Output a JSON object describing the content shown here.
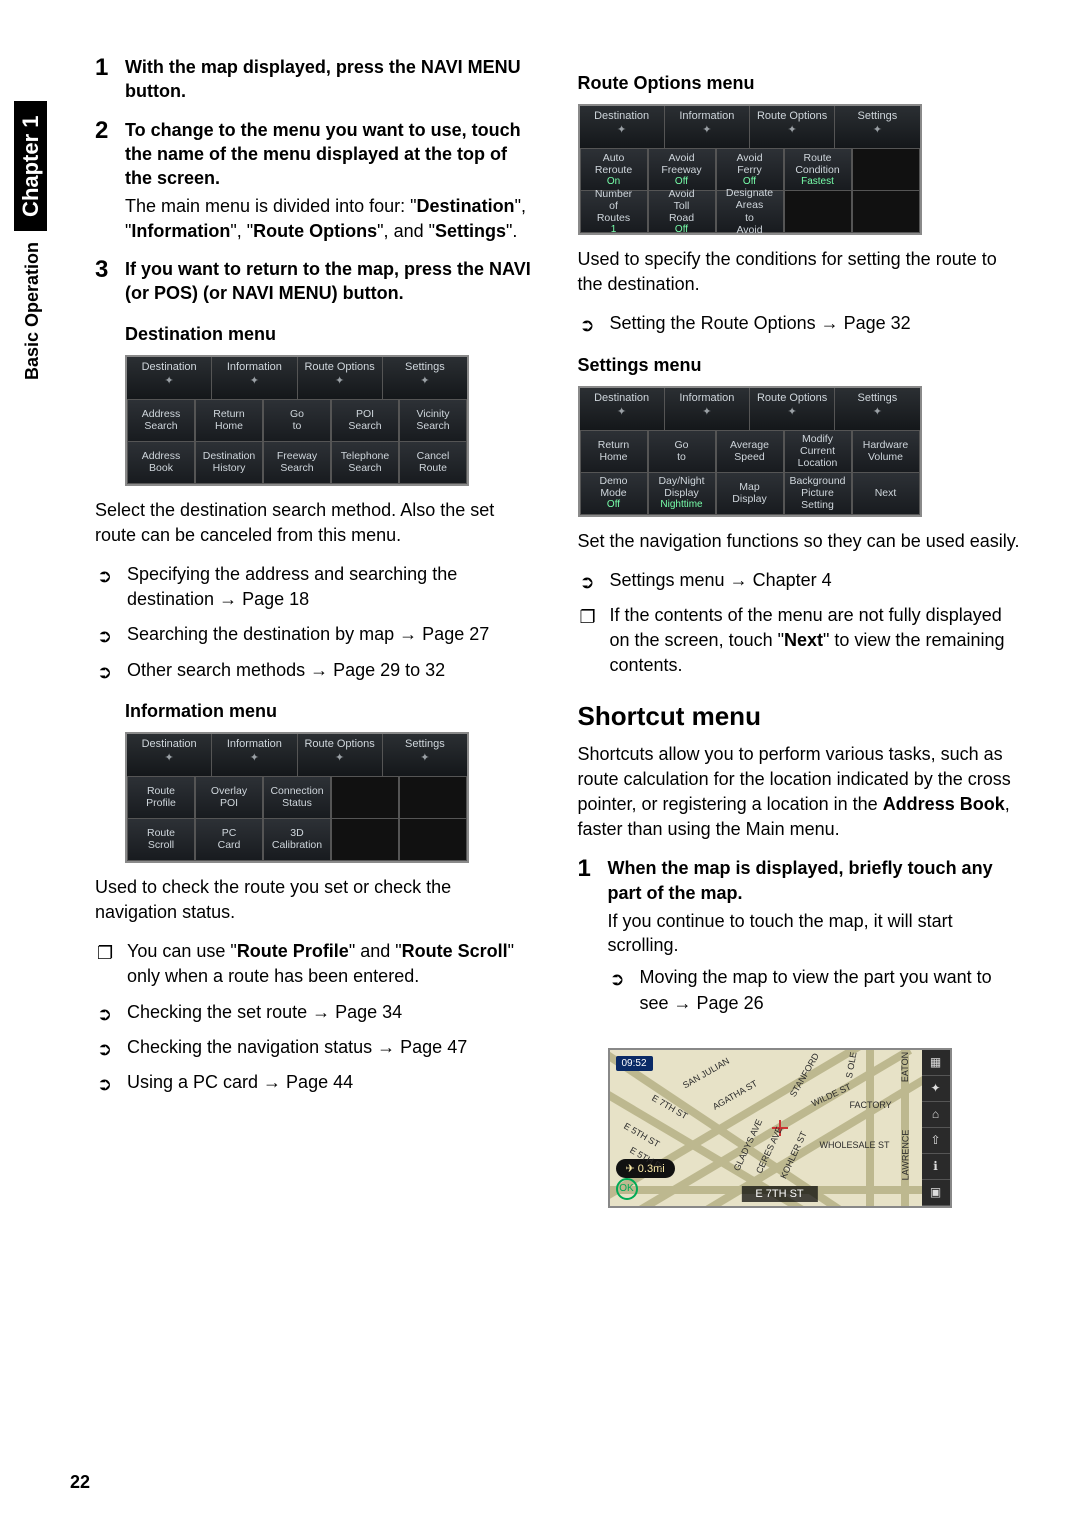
{
  "side": {
    "section": "Basic Operation",
    "chapter": "Chapter 1"
  },
  "page_number": "22",
  "steps_left": [
    {
      "num": "1",
      "lead_parts": [
        "With the map displayed, press the ",
        "NAVI MENU",
        " button."
      ],
      "detail": ""
    },
    {
      "num": "2",
      "lead": "To change to the menu you want to use, touch the name of the menu displayed at the top of the screen.",
      "detail_parts": [
        "The main menu is divided into four: \"",
        "Destination",
        "\", \"",
        "Information",
        "\", \"",
        "Route Options",
        "\", and \"",
        "Settings",
        "\"."
      ]
    },
    {
      "num": "3",
      "lead_parts": [
        "If you want to return to the map, press the ",
        "NAVI (or POS) (or NAVI MENU)",
        " button."
      ],
      "detail": ""
    }
  ],
  "tabs": [
    "Destination",
    "Information",
    "Route Options",
    "Settings"
  ],
  "dest_menu": {
    "title": "Destination menu",
    "rows": [
      [
        "Address Search",
        "Return Home",
        "Go to",
        "POI Search",
        "Vicinity Search"
      ],
      [
        "Address Book",
        "Destination History",
        "Freeway Search",
        "Telephone Search",
        "Cancel Route"
      ]
    ],
    "caption": "Select the destination search method. Also the set route can be canceled from this menu.",
    "refs": [
      {
        "m": "➲",
        "t": "Specifying the address and searching the destination → Page 18"
      },
      {
        "m": "➲",
        "t": "Searching the destination by map → Page 27"
      },
      {
        "m": "➲",
        "t": "Other search methods → Page 29 to 32"
      }
    ]
  },
  "info_menu": {
    "title": "Information menu",
    "rows": [
      [
        "Route Profile",
        "Overlay POI",
        "Connection Status",
        "",
        ""
      ],
      [
        "Route Scroll",
        "PC Card",
        "3D Calibration",
        "",
        ""
      ]
    ],
    "caption": "Used to check the route you set or check the navigation status.",
    "refs": [
      {
        "m": "❐",
        "t_parts": [
          "You can use \"",
          "Route Profile",
          "\" and \"",
          "Route Scroll",
          "\" only when a route has been entered."
        ]
      },
      {
        "m": "➲",
        "t": "Checking the set route → Page 34"
      },
      {
        "m": "➲",
        "t": "Checking the navigation status → Page 47"
      },
      {
        "m": "➲",
        "t": "Using a PC card → Page 44"
      }
    ]
  },
  "route_menu": {
    "title": "Route Options menu",
    "rows": [
      [
        {
          "t": "Auto Reroute",
          "s": "On"
        },
        {
          "t": "Avoid Freeway",
          "s": "Off"
        },
        {
          "t": "Avoid Ferry",
          "s": "Off"
        },
        {
          "t": "Route Condition",
          "s": "Fastest"
        },
        {
          "t": "",
          "s": ""
        }
      ],
      [
        {
          "t": "Number of Routes",
          "s": "1"
        },
        {
          "t": "Avoid Toll Road",
          "s": "Off"
        },
        {
          "t": "Designate Areas to Avoid",
          "s": ""
        },
        {
          "t": "",
          "s": ""
        },
        {
          "t": "",
          "s": ""
        }
      ]
    ],
    "caption": "Used to specify the conditions for setting the route to the destination.",
    "refs": [
      {
        "m": "➲",
        "t": "Setting the Route Options → Page 32"
      }
    ]
  },
  "settings_menu": {
    "title": "Settings menu",
    "rows": [
      [
        "Return Home",
        "Go to",
        "Average Speed",
        "Modify Current Location",
        "Hardware Volume"
      ],
      [
        {
          "t": "Demo Mode",
          "s": "Off"
        },
        {
          "t": "Day/Night Display",
          "s": "Nighttime"
        },
        "Map Display",
        "Background Picture Setting",
        "Next"
      ]
    ],
    "caption": "Set the navigation functions so they can be used easily.",
    "refs": [
      {
        "m": "➲",
        "t": "Settings menu → Chapter 4"
      },
      {
        "m": "❐",
        "t_parts": [
          "If the contents of the menu are not fully displayed on the screen, touch \"",
          "Next",
          "\" to view the remaining contents."
        ]
      }
    ]
  },
  "shortcut": {
    "heading": "Shortcut menu",
    "intro_parts": [
      "Shortcuts allow you to perform various tasks, such as route calculation for the location indicated by the cross pointer, or registering a location in the ",
      "Address Book",
      ", faster than using the Main menu."
    ],
    "step": {
      "num": "1",
      "lead": "When the map is displayed, briefly touch any part of the map.",
      "detail": "If you continue to touch the map, it will start scrolling.",
      "ref": {
        "m": "➲",
        "t": "Moving the map to view the part you want to see → Page 26"
      }
    },
    "map": {
      "time": "09:52",
      "distance": "0.3mi",
      "bottom": "E 7TH ST",
      "streets": [
        "SAN JULIAN",
        "AGATHA ST",
        "E 7TH ST",
        "E 5TH ST",
        "E 5TH PL",
        "GLADYS AVE",
        "CERES AVE",
        "KOHLER ST",
        "STANFORD",
        "WILDE ST",
        "FACTORY",
        "WHOLESALE ST",
        "LAWRENCE",
        "S OLE",
        "EATON"
      ],
      "ok": "OK"
    }
  }
}
